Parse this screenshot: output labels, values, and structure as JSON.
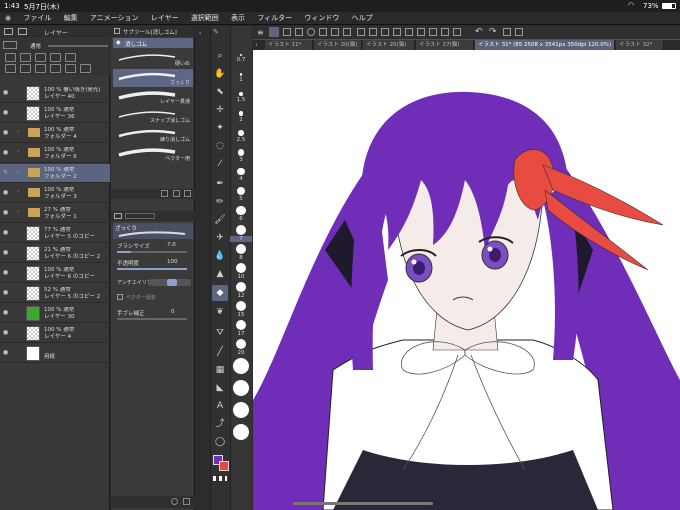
{
  "status": {
    "time": "1:43",
    "date": "5月7日(木)",
    "battery": "73%"
  },
  "menu": {
    "items": [
      "ファイル",
      "編集",
      "アニメーション",
      "レイヤー",
      "選択範囲",
      "表示",
      "フィルター",
      "ウィンドウ",
      "ヘルプ"
    ]
  },
  "layer_panel": {
    "title": "レイヤー",
    "blend_label": "通常",
    "layers": [
      {
        "name1": "100 % 覆い焼き(発光)",
        "name2": "レイヤー 40",
        "thumb": "check"
      },
      {
        "name1": "100 % 通常",
        "name2": "レイヤー 36",
        "thumb": "check"
      },
      {
        "name1": "100 % 通常",
        "name2": "フォルダー 4",
        "thumb": "folder"
      },
      {
        "name1": "100 % 通常",
        "name2": "フォルダー 6",
        "thumb": "folder"
      },
      {
        "name1": "100 % 通常",
        "name2": "フォルダー 2",
        "thumb": "folder"
      },
      {
        "name1": "100 % 通常",
        "name2": "フォルダー 3",
        "thumb": "folder"
      },
      {
        "name1": "27 % 通常",
        "name2": "フォルダー 1",
        "thumb": "folder"
      },
      {
        "name1": "77 % 通常",
        "name2": "レイヤー 5 のコピー",
        "thumb": "check"
      },
      {
        "name1": "21 % 通常",
        "name2": "レイヤー 6 のコピー 2",
        "thumb": "check"
      },
      {
        "name1": "100 % 通常",
        "name2": "レイヤー 6 のコピー",
        "thumb": "check"
      },
      {
        "name1": "52 % 通常",
        "name2": "レイヤー 5 のコピー 2",
        "thumb": "check"
      },
      {
        "name1": "100 % 通常",
        "name2": "レイヤー 30",
        "thumb": "green"
      },
      {
        "name1": "100 % 通常",
        "name2": "レイヤー 4",
        "thumb": "check"
      },
      {
        "name1": "",
        "name2": "用紙",
        "thumb": "white"
      }
    ]
  },
  "subtool": {
    "title": "サブツール[消しゴム]",
    "group": "消しゴム",
    "brushes": [
      "硬いめ",
      "ざっくり",
      "レイヤー貫通",
      "スナップ消しゴム",
      "練り消しゴム",
      "ベクター用"
    ]
  },
  "tool_property": {
    "brush_name": "ざっくり",
    "size_label": "ブラシサイズ",
    "size_value": "7.0",
    "opacity_label": "不透明度",
    "opacity_value": "100",
    "aa_label": "アンチエイリアス",
    "vector_label": "ベクター消去",
    "correction_label": "手ブレ補正",
    "correction_value": "0"
  },
  "brush_sizes": [
    "0.7",
    "1",
    "1.5",
    "2",
    "2.5",
    "3",
    "4",
    "5",
    "6",
    "7",
    "8",
    "10",
    "12",
    "15",
    "17",
    "20"
  ],
  "tabs": [
    "イラスト 11*",
    "イラスト 20(猫)",
    "イラスト 20(猫)",
    "イラスト 27(猫)",
    "イラスト 31* (85 2508 x 3541px 350dpi 120.0%)",
    "イラスト 32*"
  ],
  "colors": {
    "main": "#6a34b8",
    "sub": "#e8483f",
    "hair": "#6f2db8",
    "ribbon": "#e84c41"
  }
}
